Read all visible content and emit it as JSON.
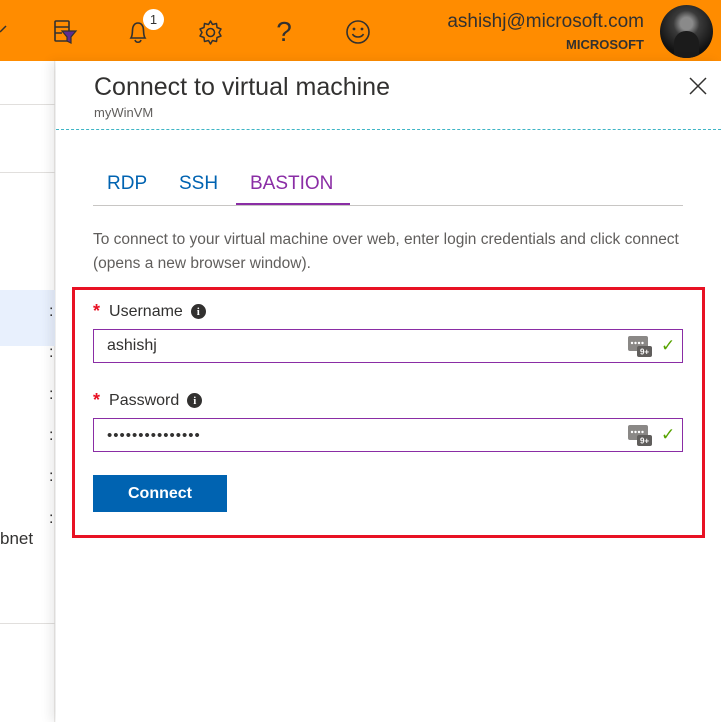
{
  "topbar": {
    "notification_count": "1",
    "help_glyph": "?",
    "account_email": "ashishj@microsoft.com",
    "account_org": "MICROSOFT",
    "color": "#ff8c00"
  },
  "left_panel": {
    "partial_text": "bnet"
  },
  "blade": {
    "title": "Connect to virtual machine",
    "subtitle": "myWinVM",
    "tabs": [
      {
        "label": "RDP",
        "active": false
      },
      {
        "label": "SSH",
        "active": false
      },
      {
        "label": "BASTION",
        "active": true
      }
    ],
    "description": "To connect to your virtual machine over web, enter login credentials and click connect (opens a new browser window).",
    "username": {
      "label": "Username",
      "value": "ashishj"
    },
    "password": {
      "label": "Password",
      "value": "•••••••••••••••"
    },
    "connect_label": "Connect",
    "password_manager_badge": "9+"
  },
  "colors": {
    "accent_purple": "#8a2da5",
    "link_blue": "#0063b1",
    "required_red": "#e81123",
    "valid_green": "#57a300"
  }
}
